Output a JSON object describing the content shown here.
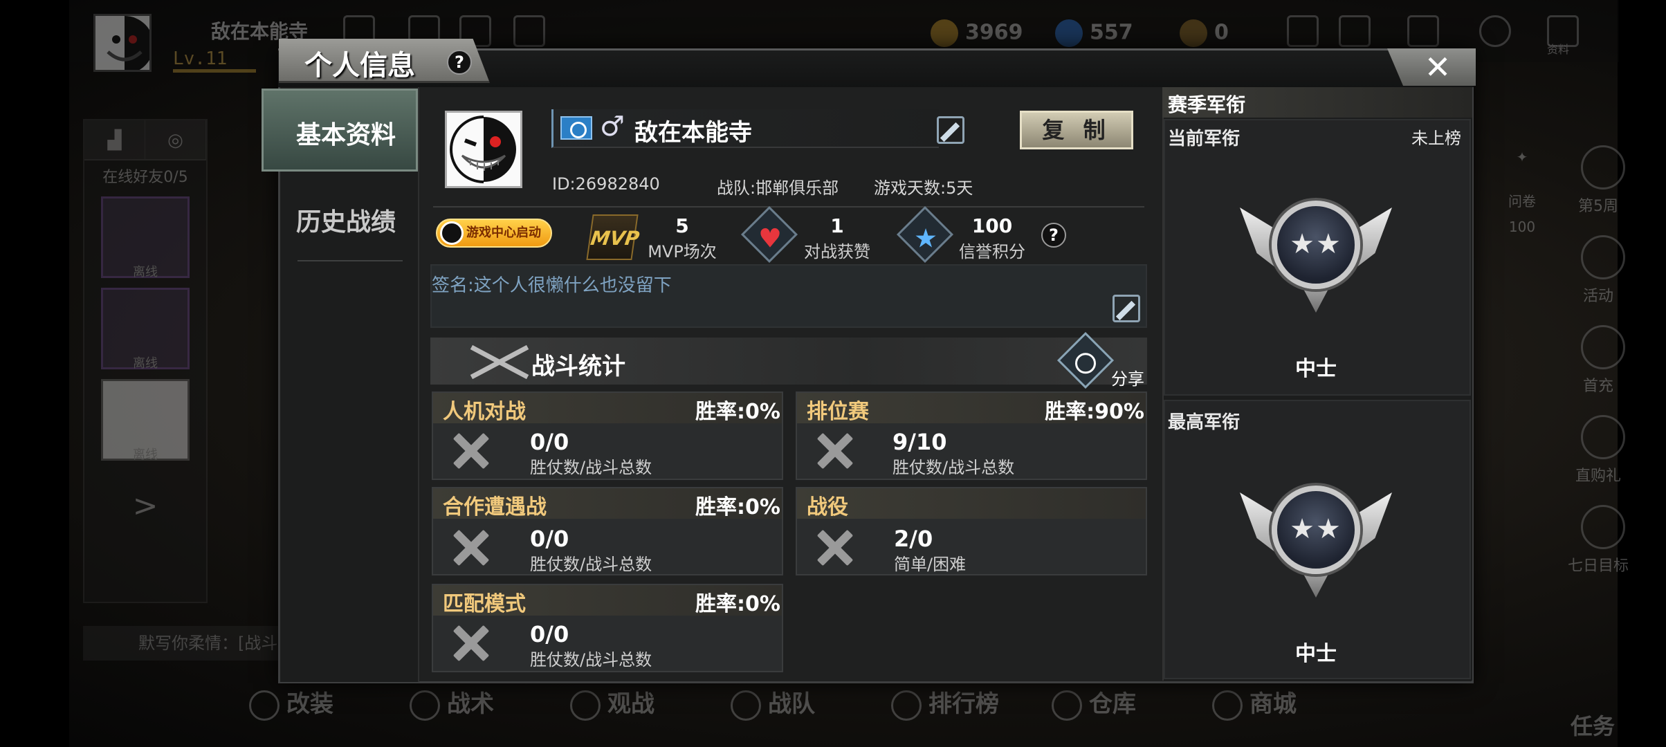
{
  "background": {
    "player_name": "敌在本能寺",
    "level": "Lv.11",
    "gold": "3969",
    "diamonds": "557",
    "tickets": "0",
    "friends_online": "在线好友0/5",
    "friend_status": [
      "离线",
      "离线",
      "离线"
    ],
    "chat_text": "默写你柔情：[战斗",
    "bottom_nav": [
      "改装",
      "战术",
      "观战",
      "战队",
      "排行榜",
      "仓库",
      "商城"
    ],
    "right_col": [
      "第5周",
      "活动",
      "首充",
      "直购礼",
      "七日目标"
    ],
    "questionnaire": "问卷",
    "questionnaire_count": "100",
    "task": "任务",
    "resource_label": "资料"
  },
  "modal": {
    "title": "个人信息",
    "help": "?",
    "close": "✕",
    "menu": [
      "基本资料",
      "历史战绩"
    ],
    "profile": {
      "gender_symbol": "♂",
      "name": "敌在本能寺",
      "copy_label": "复 制",
      "id_text": "ID:26982840",
      "team_text": "战队:邯郸俱乐部",
      "days_text": "游戏天数:5天",
      "qq_button": "游戏中心启动"
    },
    "stats": [
      {
        "icon": "mvp-icon",
        "icon_text": "MVP",
        "value": "5",
        "label": "MVP场次"
      },
      {
        "icon": "heart-icon",
        "value": "1",
        "label": "对战获赞"
      },
      {
        "icon": "star-icon",
        "value": "100",
        "label": "信誉积分"
      }
    ],
    "signature": "签名:这个人很懒什么也没留下",
    "combat": {
      "title": "战斗统计",
      "share": "分享",
      "modes": [
        {
          "name": "人机对战",
          "rate": "胜率:0%",
          "value": "0/0",
          "sub": "胜仗数/战斗总数"
        },
        {
          "name": "排位赛",
          "rate": "胜率:90%",
          "value": "9/10",
          "sub": "胜仗数/战斗总数"
        },
        {
          "name": "合作遭遇战",
          "rate": "胜率:0%",
          "value": "0/0",
          "sub": "胜仗数/战斗总数"
        },
        {
          "name": "战役",
          "rate": "",
          "value": "2/0",
          "sub": "简单/困难"
        },
        {
          "name": "匹配模式",
          "rate": "胜率:0%",
          "value": "0/0",
          "sub": "胜仗数/战斗总数"
        }
      ]
    },
    "rank": {
      "header": "赛季军衔",
      "current_label": "当前军衔",
      "current_status": "未上榜",
      "current_rank": "中士",
      "highest_label": "最高军衔",
      "highest_rank": "中士",
      "stars": "★★"
    }
  },
  "colors": {
    "accent_gold": "#f1c97c",
    "menu_active": "#5f7369",
    "signature_blue": "#7fa3c2"
  }
}
